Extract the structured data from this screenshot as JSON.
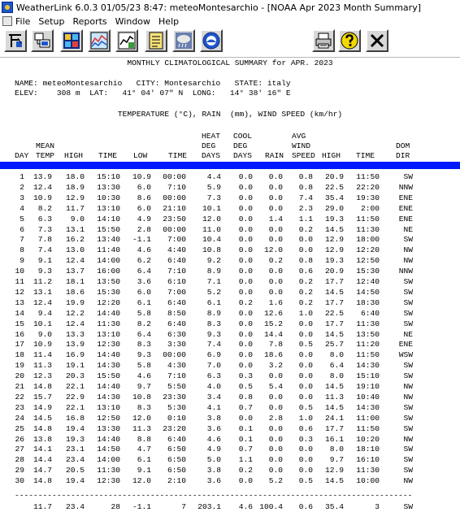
{
  "window": {
    "title": "WeatherLink 6.0.3  01/05/23  8:47: meteoMontesarchio - [NOAA Apr 2023 Month Summary]"
  },
  "menu": [
    "File",
    "Setup",
    "Reports",
    "Window",
    "Help"
  ],
  "toolbar_icons": [
    "station-wizard-icon",
    "download-icon",
    "bulletin-icon",
    "strip-chart-icon",
    "plot-icon",
    "notebook-icon",
    "weather-summary-icon",
    "noaa-icon",
    "print-icon",
    "help-icon",
    "close-icon"
  ],
  "report": {
    "title": "MONTHLY CLIMATOLOGICAL SUMMARY for APR. 2023",
    "info_line1": "NAME: meteoMontesarchio   CITY: Montesarchio   STATE: italy",
    "info_line2": "ELEV:    308 m  LAT:   41° 04' 07\" N  LONG:   14° 38' 16\" E",
    "units_line": "TEMPERATURE (°C), RAIN  (mm), WIND SPEED (km/hr)",
    "header_row1": [
      "",
      "",
      "",
      "",
      "",
      "",
      "HEAT",
      "COOL",
      "",
      "AVG",
      "",
      "",
      ""
    ],
    "header_row2": [
      "",
      "MEAN",
      "",
      "",
      "",
      "",
      "DEG",
      "DEG",
      "",
      "WIND",
      "",
      "",
      "DOM"
    ],
    "header_row3": [
      "DAY",
      "TEMP",
      "HIGH",
      "TIME",
      "LOW",
      "TIME",
      "DAYS",
      "DAYS",
      "RAIN",
      "SPEED",
      "HIGH",
      "TIME",
      "DIR"
    ],
    "rows": [
      [
        "1",
        "13.9",
        "18.0",
        "15:10",
        "10.9",
        "00:00",
        "4.4",
        "0.0",
        "0.0",
        "0.8",
        "20.9",
        "11:50",
        "SW"
      ],
      [
        "2",
        "12.4",
        "18.9",
        "13:30",
        "6.0",
        "7:10",
        "5.9",
        "0.0",
        "0.0",
        "0.8",
        "22.5",
        "22:20",
        "NNW"
      ],
      [
        "3",
        "10.9",
        "12.9",
        "10:30",
        "8.6",
        "00:00",
        "7.3",
        "0.0",
        "0.0",
        "7.4",
        "35.4",
        "19:30",
        "ENE"
      ],
      [
        "4",
        "8.2",
        "11.7",
        "13:10",
        "6.0",
        "21:10",
        "10.1",
        "0.0",
        "0.0",
        "2.3",
        "29.0",
        "2:00",
        "ENE"
      ],
      [
        "5",
        "6.3",
        "9.0",
        "14:10",
        "4.9",
        "23:50",
        "12.0",
        "0.0",
        "1.4",
        "1.1",
        "19.3",
        "11:50",
        "ENE"
      ],
      [
        "6",
        "7.3",
        "13.1",
        "15:50",
        "2.8",
        "00:00",
        "11.0",
        "0.0",
        "0.0",
        "0.2",
        "14.5",
        "11:30",
        "NE"
      ],
      [
        "7",
        "7.8",
        "16.2",
        "13:40",
        "-1.1",
        "7:00",
        "10.4",
        "0.0",
        "0.0",
        "0.0",
        "12.9",
        "18:00",
        "SW"
      ],
      [
        "8",
        "7.4",
        "13.0",
        "11:40",
        "4.6",
        "4:40",
        "10.8",
        "0.0",
        "12.0",
        "0.0",
        "12.9",
        "12:20",
        "NW"
      ],
      [
        "9",
        "9.1",
        "12.4",
        "14:00",
        "6.2",
        "6:40",
        "9.2",
        "0.0",
        "0.2",
        "0.8",
        "19.3",
        "12:50",
        "NW"
      ],
      [
        "10",
        "9.3",
        "13.7",
        "16:00",
        "6.4",
        "7:10",
        "8.9",
        "0.0",
        "0.0",
        "0.6",
        "20.9",
        "15:30",
        "NNW"
      ],
      [
        "11",
        "11.2",
        "18.1",
        "13:50",
        "3.6",
        "6:10",
        "7.1",
        "0.0",
        "0.0",
        "0.2",
        "17.7",
        "12:40",
        "SW"
      ],
      [
        "12",
        "13.1",
        "18.6",
        "15:30",
        "6.0",
        "7:00",
        "5.2",
        "0.0",
        "0.0",
        "0.2",
        "14.5",
        "14:50",
        "SW"
      ],
      [
        "13",
        "12.4",
        "19.9",
        "12:20",
        "6.1",
        "6:40",
        "6.1",
        "0.2",
        "1.6",
        "0.2",
        "17.7",
        "18:30",
        "SW"
      ],
      [
        "14",
        "9.4",
        "12.2",
        "14:40",
        "5.8",
        "8:50",
        "8.9",
        "0.0",
        "12.6",
        "1.0",
        "22.5",
        "6:40",
        "SW"
      ],
      [
        "15",
        "10.1",
        "12.4",
        "11:30",
        "8.2",
        "6:40",
        "8.3",
        "0.0",
        "15.2",
        "0.0",
        "17.7",
        "11:30",
        "SW"
      ],
      [
        "16",
        "9.0",
        "13.3",
        "13:10",
        "6.4",
        "6:30",
        "9.3",
        "0.0",
        "14.4",
        "0.0",
        "14.5",
        "13:50",
        "NE"
      ],
      [
        "17",
        "10.9",
        "13.9",
        "12:30",
        "8.3",
        "3:30",
        "7.4",
        "0.0",
        "7.8",
        "0.5",
        "25.7",
        "11:20",
        "ENE"
      ],
      [
        "18",
        "11.4",
        "16.9",
        "14:40",
        "9.3",
        "00:00",
        "6.9",
        "0.0",
        "18.6",
        "0.0",
        "8.0",
        "11:50",
        "WSW"
      ],
      [
        "19",
        "11.3",
        "19.1",
        "14:30",
        "5.8",
        "4:30",
        "7.0",
        "0.0",
        "3.2",
        "0.0",
        "6.4",
        "14:30",
        "SW"
      ],
      [
        "20",
        "12.3",
        "20.3",
        "15:50",
        "4.6",
        "7:10",
        "6.3",
        "0.3",
        "0.0",
        "0.0",
        "8.0",
        "15:10",
        "SW"
      ],
      [
        "21",
        "14.8",
        "22.1",
        "14:40",
        "9.7",
        "5:50",
        "4.0",
        "0.5",
        "5.4",
        "0.0",
        "14.5",
        "19:10",
        "NW"
      ],
      [
        "22",
        "15.7",
        "22.9",
        "14:30",
        "10.8",
        "23:30",
        "3.4",
        "0.8",
        "0.0",
        "0.0",
        "11.3",
        "10:40",
        "NW"
      ],
      [
        "23",
        "14.9",
        "22.1",
        "13:10",
        "8.3",
        "5:30",
        "4.1",
        "0.7",
        "0.0",
        "0.5",
        "14.5",
        "14:30",
        "SW"
      ],
      [
        "24",
        "14.5",
        "16.8",
        "12:50",
        "12.0",
        "0:10",
        "3.8",
        "0.0",
        "2.8",
        "1.0",
        "24.1",
        "11:00",
        "SW"
      ],
      [
        "25",
        "14.8",
        "19.4",
        "13:30",
        "11.3",
        "23:20",
        "3.6",
        "0.1",
        "0.0",
        "0.6",
        "17.7",
        "11:50",
        "SW"
      ],
      [
        "26",
        "13.8",
        "19.3",
        "14:40",
        "8.8",
        "6:40",
        "4.6",
        "0.1",
        "0.0",
        "0.3",
        "16.1",
        "10:20",
        "NW"
      ],
      [
        "27",
        "14.1",
        "23.1",
        "14:50",
        "4.7",
        "6:50",
        "4.9",
        "0.7",
        "0.0",
        "0.0",
        "8.0",
        "18:10",
        "SW"
      ],
      [
        "28",
        "14.4",
        "23.4",
        "14:00",
        "6.1",
        "6:50",
        "5.0",
        "1.1",
        "0.0",
        "0.0",
        "9.7",
        "16:10",
        "SW"
      ],
      [
        "29",
        "14.7",
        "20.5",
        "11:30",
        "9.1",
        "6:50",
        "3.8",
        "0.2",
        "0.0",
        "0.0",
        "12.9",
        "11:30",
        "SW"
      ],
      [
        "30",
        "14.8",
        "19.4",
        "12:30",
        "12.0",
        "2:10",
        "3.6",
        "0.0",
        "5.2",
        "0.5",
        "14.5",
        "10:00",
        "NW"
      ]
    ],
    "separator": "-------------------------------------------------------------------------------------",
    "totals": [
      "",
      "11.7",
      "23.4",
      "28",
      "-1.1",
      "7",
      "203.1",
      "4.6",
      "100.4",
      "0.6",
      "35.4",
      "3",
      "SW"
    ]
  }
}
